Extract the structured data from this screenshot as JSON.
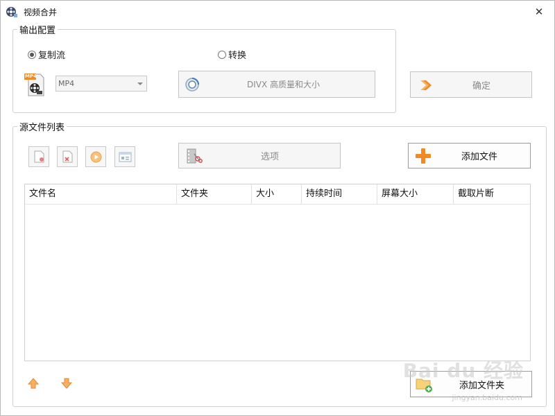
{
  "window": {
    "title": "视频合并",
    "close_glyph": "✕"
  },
  "output": {
    "legend": "输出配置",
    "radio_copy": "复制流",
    "radio_convert": "转换",
    "selected": "copy",
    "format_icon_text": "MP4",
    "format_value": "MP4",
    "quality_button": "DIVX 高质量和大小",
    "confirm_button": "确定"
  },
  "source": {
    "legend": "源文件列表",
    "tools": [
      "add-file-icon",
      "remove-file-icon",
      "play-icon",
      "info-icon"
    ],
    "options_button": "选项",
    "add_file_button": "添加文件",
    "columns": [
      "文件名",
      "文件夹",
      "大小",
      "持续时间",
      "屏幕大小",
      "截取片断"
    ],
    "rows": [],
    "add_folder_button": "添加文件夹"
  },
  "watermark": {
    "text": "Bai du 经验",
    "sub": "jingyan.baidu.com"
  },
  "colors": {
    "accent_orange": "#f08a24",
    "border": "#adadad"
  }
}
